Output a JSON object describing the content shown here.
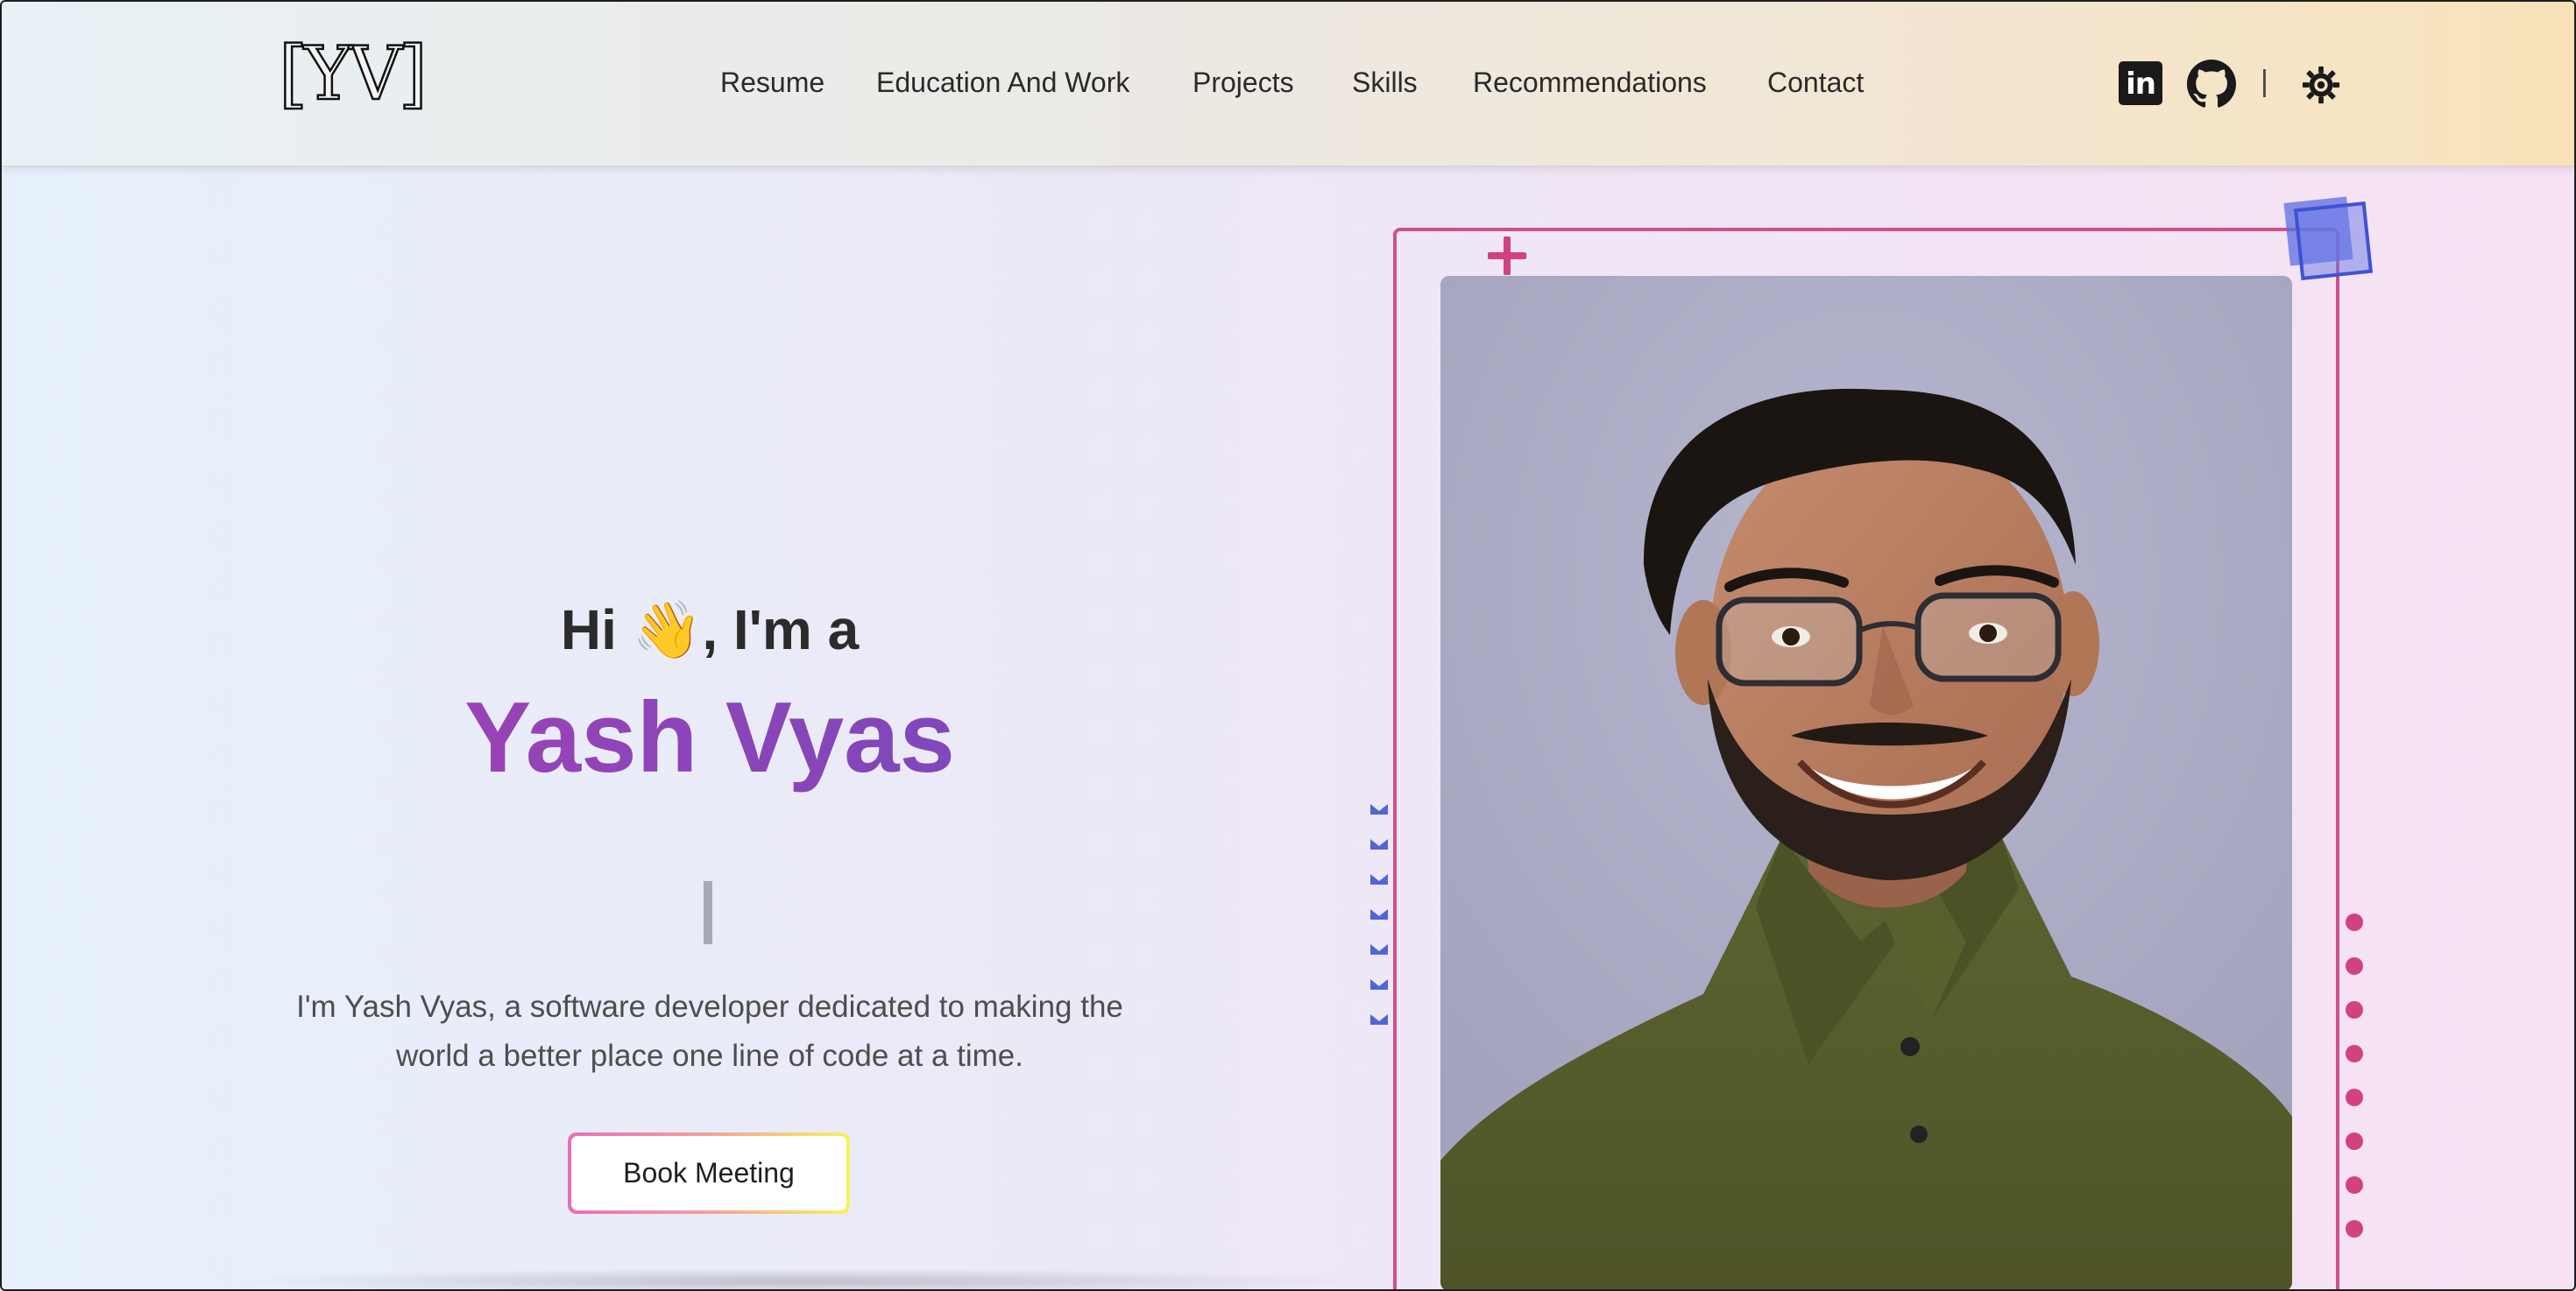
{
  "header": {
    "logo_text": "[YV]",
    "nav": [
      {
        "label": "Resume"
      },
      {
        "label": "Education And Work"
      },
      {
        "label": "Projects"
      },
      {
        "label": "Skills"
      },
      {
        "label": "Recommendations"
      },
      {
        "label": "Contact"
      }
    ],
    "social": {
      "linkedin_icon": "linkedin-icon",
      "linkedin_glyph": "in",
      "github_icon": "github-icon",
      "separator": "|",
      "theme_icon": "sun-gear-icon"
    }
  },
  "hero": {
    "greeting": "Hi 👋, I'm a",
    "name": "Yash Vyas",
    "tagline_line1": "I'm Yash Vyas, a software developer dedicated to making the",
    "tagline_line2": "world a better place one line of code at a time.",
    "cta_label": "Book Meeting"
  },
  "colors": {
    "accent_pink": "#d14f8c",
    "accent_blue": "#4a5cd6",
    "name_gradient_start": "#b23fb2",
    "name_gradient_end": "#6a51c0"
  }
}
